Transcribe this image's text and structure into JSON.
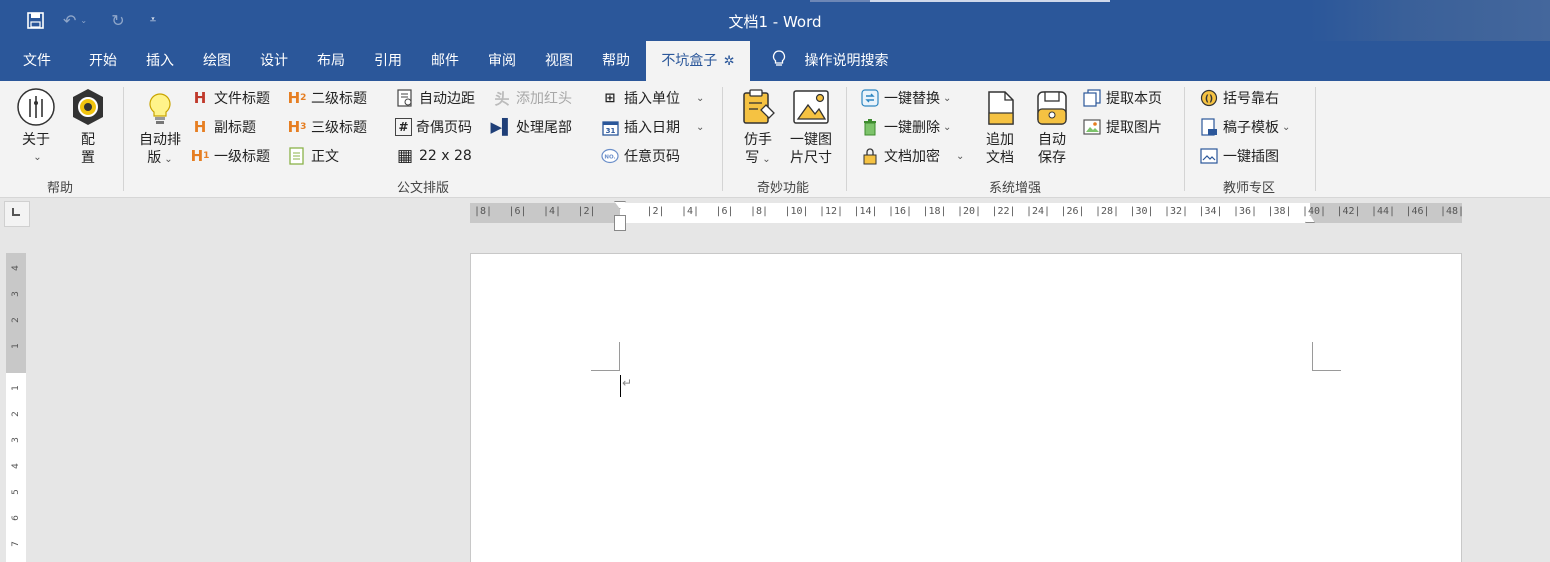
{
  "titlebar": {
    "title": "文档1  -  Word"
  },
  "tabs": [
    {
      "label": "文件"
    },
    {
      "label": "开始"
    },
    {
      "label": "插入"
    },
    {
      "label": "绘图"
    },
    {
      "label": "设计"
    },
    {
      "label": "布局"
    },
    {
      "label": "引用"
    },
    {
      "label": "邮件"
    },
    {
      "label": "审阅"
    },
    {
      "label": "视图"
    },
    {
      "label": "帮助"
    },
    {
      "label": "不坑盒子"
    }
  ],
  "search": {
    "label": "操作说明搜索"
  },
  "groups": {
    "help": {
      "label": "帮助",
      "about": "关于",
      "config_1": "配",
      "config_2": "置"
    },
    "gongwen": {
      "label": "公文排版",
      "auto_layout_1": "自动排",
      "auto_layout_2": "版",
      "file_title": "文件标题",
      "sub_title": "副标题",
      "h1": "一级标题",
      "h2": "二级标题",
      "h3": "三级标题",
      "body": "正文",
      "auto_margin": "自动边距",
      "odd_even_page": "奇偶页码",
      "grid": "22 x 28",
      "add_red_head": "添加红头",
      "process_tail": "处理尾部",
      "insert_unit": "插入单位",
      "insert_date": "插入日期",
      "any_page_num": "任意页码"
    },
    "qimiao": {
      "label": "奇妙功能",
      "handwrite_1": "仿手",
      "handwrite_2": "写",
      "resize_1": "一键图",
      "resize_2": "片尺寸"
    },
    "system": {
      "label": "系统增强",
      "replace": "一键替换",
      "delete": "一键删除",
      "encrypt": "文档加密",
      "append_1": "追加",
      "append_2": "文档",
      "autosave_1": "自动",
      "autosave_2": "保存",
      "extract_page": "提取本页",
      "extract_img": "提取图片"
    },
    "teacher": {
      "label": "教师专区",
      "bracket_right": "括号靠右",
      "template": "稿子模板",
      "insert_img": "一键插图"
    }
  },
  "ruler": {
    "left_ticks": [
      "8",
      "6",
      "4",
      "2"
    ],
    "right_ticks": [
      "2",
      "4",
      "6",
      "8",
      "10",
      "12",
      "14",
      "16",
      "18",
      "20",
      "22",
      "24",
      "26",
      "28",
      "30",
      "32",
      "34",
      "36",
      "38",
      "40",
      "42",
      "44",
      "46",
      "48"
    ],
    "vertical_ticks": [
      "4",
      "3",
      "2",
      "1",
      "1",
      "2",
      "3",
      "4",
      "5",
      "6",
      "7"
    ]
  },
  "colors": {
    "brand_blue": "#2b579a",
    "ribbon_bg": "#f3f3f3",
    "heading_red": "#c0392b",
    "heading_orange": "#e67e22"
  }
}
